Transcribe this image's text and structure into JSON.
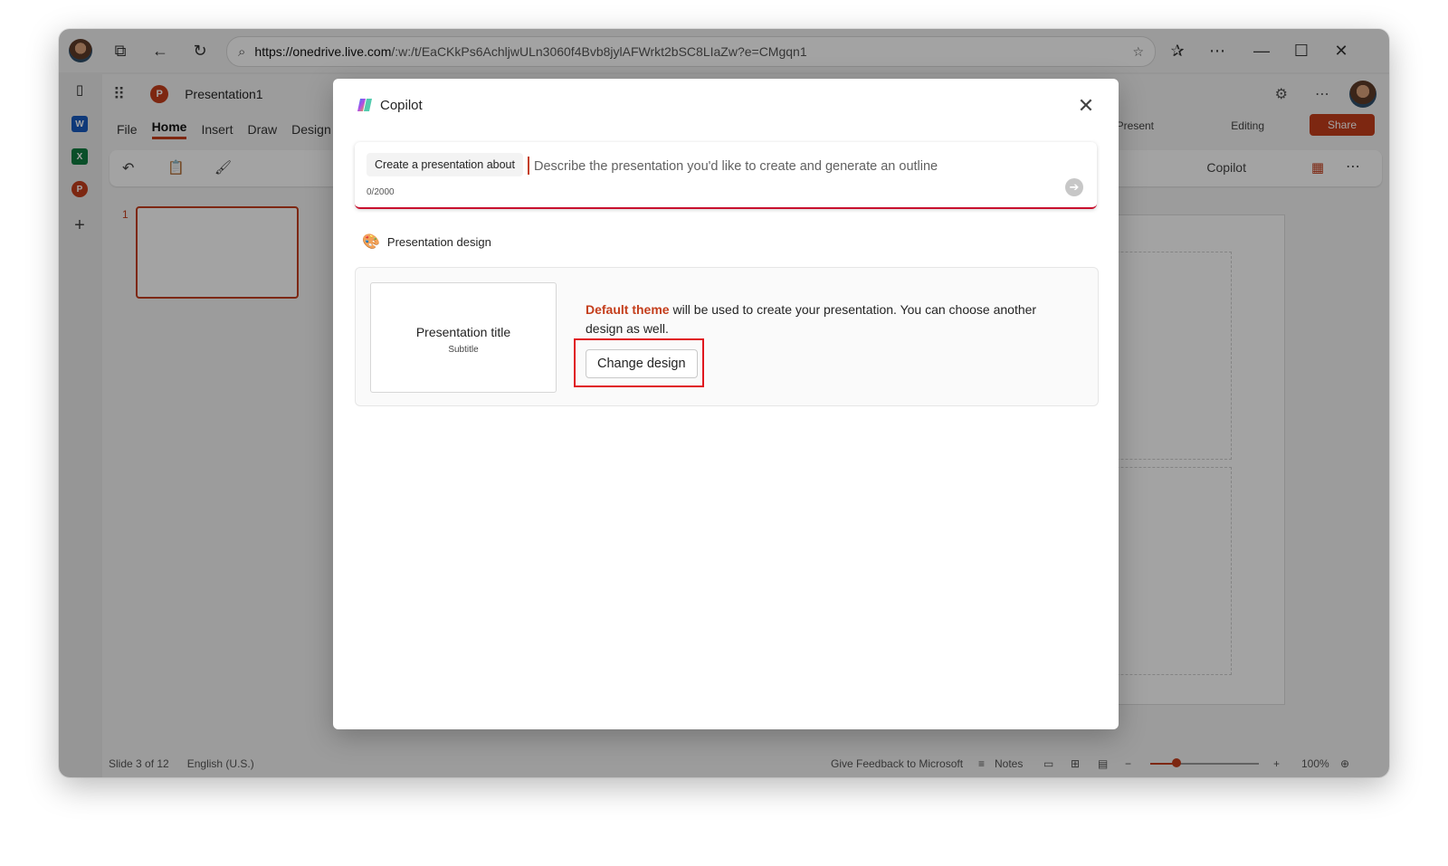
{
  "browser": {
    "url_host": "https://onedrive.live.com",
    "url_path": "/:w:/t/EaCKkPs6AchljwULn3060f4Bvb8jylAFWrkt2bSC8LIaZw?e=CMgqn1"
  },
  "app": {
    "doc_title": "Presentation1",
    "tabs": [
      "File",
      "Home",
      "Insert",
      "Draw",
      "Design"
    ],
    "right_buttons": {
      "present": "Present",
      "editing": "Editing",
      "share": "Share",
      "copilot": "Copilot"
    },
    "slide_number": "1"
  },
  "status": {
    "slide": "Slide 3 of 12",
    "language": "English (U.S.)",
    "feedback": "Give Feedback to Microsoft",
    "notes": "Notes",
    "zoom": "100%",
    "zoom_level_percent": 24
  },
  "copilot": {
    "title": "Copilot",
    "prompt_chip": "Create a presentation about",
    "prompt_placeholder": "Describe the presentation you'd like to create and generate an outline",
    "counter": "0/2000",
    "design_section": "Presentation design",
    "preview_title": "Presentation title",
    "preview_subtitle": "Subtitle",
    "theme_highlight": "Default theme",
    "theme_description": "will be used to create your presentation. You can choose another design as well.",
    "change_design": "Change design"
  },
  "colors": {
    "accent": "#c43e1c",
    "highlight_box": "#e0161e"
  }
}
